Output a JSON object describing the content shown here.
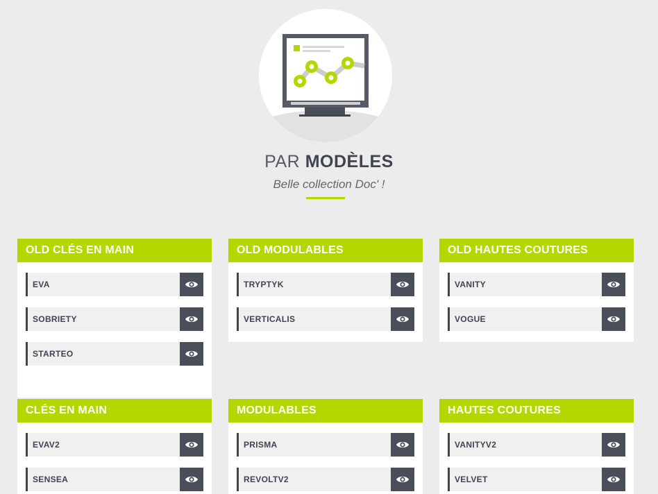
{
  "hero": {
    "title_light": "PAR",
    "title_bold": "MODÈLES",
    "subtitle": "Belle collection Doc' !"
  },
  "colors": {
    "accent": "#b4d700",
    "dark": "#4a4e58",
    "background": "#ececec"
  },
  "icons": {
    "hero": "monitor-chart-icon",
    "view": "eye-icon"
  },
  "categories": [
    {
      "title": "OLD CLÉS EN MAIN",
      "items": [
        "EVA",
        "SOBRIETY",
        "STARTEO"
      ]
    },
    {
      "title": "OLD MODULABLES",
      "items": [
        "TRYPTYK",
        "VERTICALIS"
      ]
    },
    {
      "title": "OLD HAUTES COUTURES",
      "items": [
        "VANITY",
        "VOGUE"
      ]
    },
    {
      "title": "CLÉS EN MAIN",
      "items": [
        "EVAV2",
        "SENSEA"
      ]
    },
    {
      "title": "MODULABLES",
      "items": [
        "PRISMA",
        "REVOLTV2"
      ]
    },
    {
      "title": "HAUTES COUTURES",
      "items": [
        "VANITYV2",
        "VELVET"
      ]
    }
  ]
}
